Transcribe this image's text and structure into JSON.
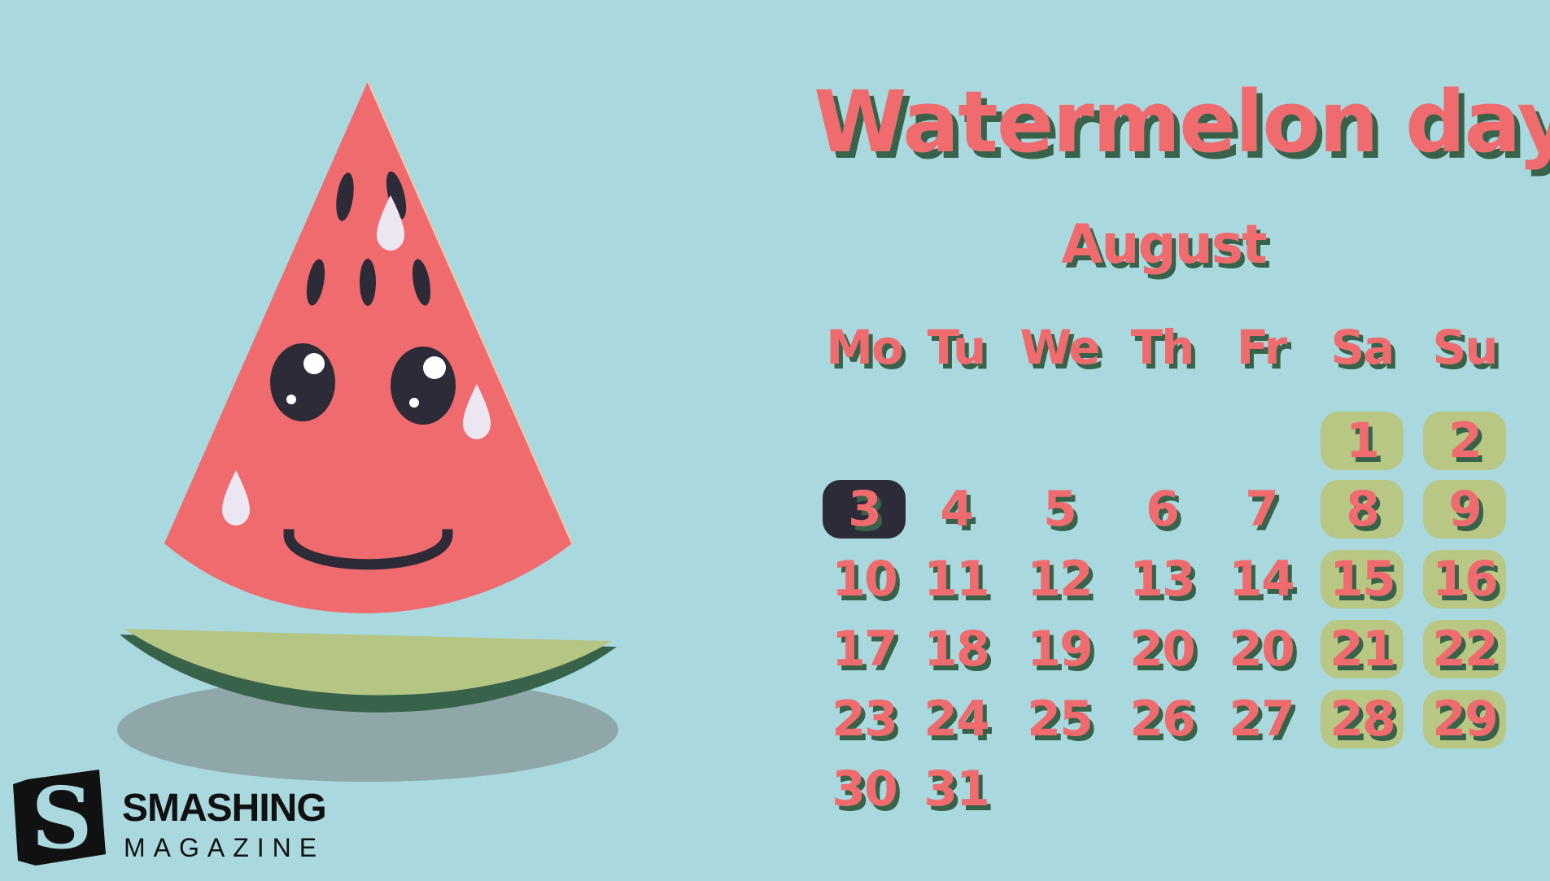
{
  "title": "Watermelon day",
  "month": "August",
  "weekdays": [
    "Mo",
    "Tu",
    "We",
    "Th",
    "Fr",
    "Sa",
    "Su"
  ],
  "weeks": [
    [
      "",
      "",
      "",
      "",
      "",
      "1",
      "2"
    ],
    [
      "3",
      "4",
      "5",
      "6",
      "7",
      "8",
      "9"
    ],
    [
      "10",
      "11",
      "12",
      "13",
      "14",
      "15",
      "16"
    ],
    [
      "17",
      "18",
      "19",
      "20",
      "20",
      "21",
      "22"
    ],
    [
      "23",
      "24",
      "25",
      "26",
      "27",
      "28",
      "29"
    ],
    [
      "30",
      "31",
      "",
      "",
      "",
      "",
      ""
    ]
  ],
  "highlighted_day": "3",
  "logo": {
    "name": "SMASHING",
    "sub": "MAGAZINE",
    "icon": "smashing-s-logo-icon"
  },
  "colors": {
    "background": "#a9d9df",
    "flesh": "#ef6b6e",
    "rind_light": "#b5c584",
    "rind_dark": "#38634a",
    "text_shadow": "#38634a",
    "weekend_badge": "#b8c784",
    "today_badge": "#2e2b38"
  }
}
